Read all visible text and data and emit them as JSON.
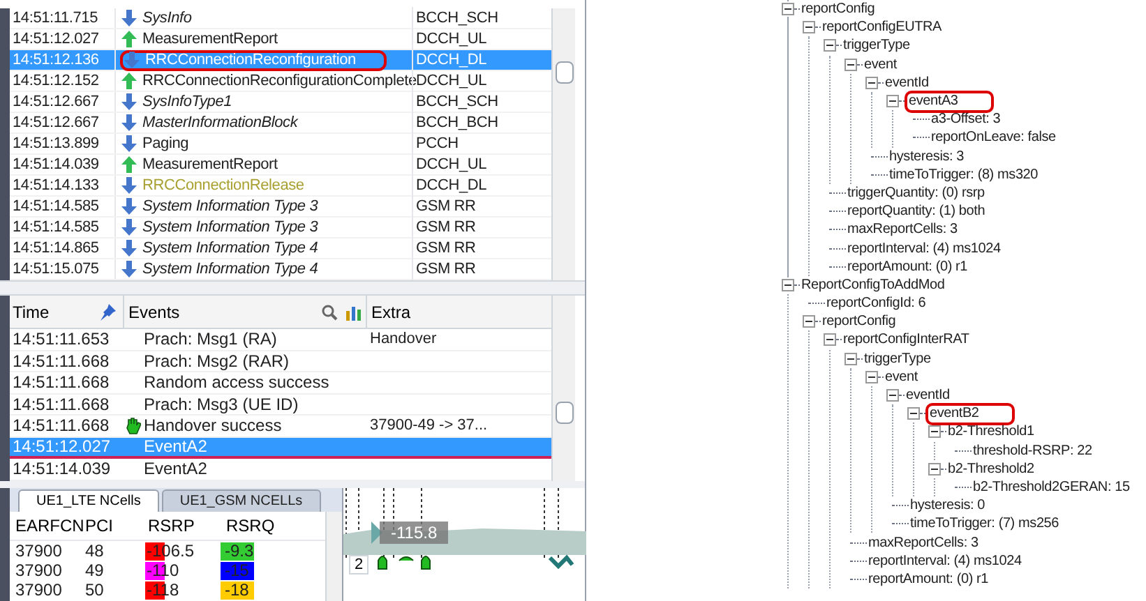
{
  "messages": {
    "rows": [
      {
        "time": "14:51:11.715",
        "kind": "downlink",
        "message": "SysInfo",
        "italic": true,
        "channel": "BCCH_SCH",
        "selected": false,
        "highlighted": false
      },
      {
        "time": "14:51:12.027",
        "kind": "uplink",
        "message": "MeasurementReport",
        "italic": false,
        "channel": "DCCH_UL",
        "selected": false,
        "highlighted": false
      },
      {
        "time": "14:51:12.136",
        "kind": "downlink",
        "message": "RRCConnectionReconfiguration",
        "italic": false,
        "channel": "DCCH_DL",
        "selected": true,
        "highlighted": true
      },
      {
        "time": "14:51:12.152",
        "kind": "uplink",
        "message": "RRCConnectionReconfigurationComplete",
        "italic": false,
        "channel": "DCCH_UL",
        "selected": false,
        "highlighted": false
      },
      {
        "time": "14:51:12.667",
        "kind": "downlink",
        "message": "SysInfoType1",
        "italic": true,
        "channel": "BCCH_SCH",
        "selected": false,
        "highlighted": false
      },
      {
        "time": "14:51:12.667",
        "kind": "downlink",
        "message": "MasterInformationBlock",
        "italic": true,
        "channel": "BCCH_BCH",
        "selected": false,
        "highlighted": false
      },
      {
        "time": "14:51:13.899",
        "kind": "downlink",
        "message": "Paging",
        "italic": false,
        "channel": "PCCH",
        "selected": false,
        "highlighted": false
      },
      {
        "time": "14:51:14.039",
        "kind": "uplink",
        "message": "MeasurementReport",
        "italic": false,
        "channel": "DCCH_UL",
        "selected": false,
        "highlighted": false
      },
      {
        "time": "14:51:14.133",
        "kind": "downlink",
        "message": "RRCConnectionRelease",
        "italic": false,
        "color": "#a8a030",
        "channel": "DCCH_DL",
        "selected": false,
        "highlighted": false
      },
      {
        "time": "14:51:14.585",
        "kind": "downlink",
        "message": "System Information Type 3",
        "italic": true,
        "channel": "GSM RR",
        "selected": false,
        "highlighted": false
      },
      {
        "time": "14:51:14.585",
        "kind": "downlink",
        "message": "System Information Type 3",
        "italic": true,
        "channel": "GSM RR",
        "selected": false,
        "highlighted": false
      },
      {
        "time": "14:51:14.865",
        "kind": "downlink",
        "message": "System Information Type 4",
        "italic": true,
        "channel": "GSM RR",
        "selected": false,
        "highlighted": false
      },
      {
        "time": "14:51:15.075",
        "kind": "downlink",
        "message": "System Information Type 4",
        "italic": true,
        "channel": "GSM RR",
        "selected": false,
        "highlighted": false
      }
    ]
  },
  "events": {
    "columns": [
      "Time",
      "Events",
      "Extra"
    ],
    "rows": [
      {
        "time": "14:51:11.653",
        "event": "Prach: Msg1 (RA)",
        "extra": "Handover",
        "kind": "plain",
        "selected": false
      },
      {
        "time": "14:51:11.668",
        "event": "Prach: Msg2 (RAR)",
        "kind": "plain",
        "selected": false
      },
      {
        "time": "14:51:11.668",
        "event": "Random access success",
        "kind": "plain",
        "selected": false
      },
      {
        "time": "14:51:11.668",
        "event": "Prach: Msg3 (UE ID)",
        "kind": "plain",
        "selected": false
      },
      {
        "time": "14:51:11.668",
        "event": "Handover success",
        "extra": "37900-49 -> 37...",
        "kind": "handover",
        "selected": false
      },
      {
        "time": "14:51:12.027",
        "event": "EventA2",
        "kind": "plain",
        "selected": true
      },
      {
        "time": "14:51:14.039",
        "event": "EventA2",
        "kind": "plain",
        "selected": false
      }
    ]
  },
  "ncells": {
    "tabs": [
      {
        "label": "UE1_LTE NCells",
        "selected": true
      },
      {
        "label": "UE1_GSM NCELLs",
        "selected": false
      }
    ],
    "columns": [
      "EARFCN",
      "PCI",
      "RSRP",
      "RSRQ"
    ],
    "rows": [
      {
        "earfcn": "37900",
        "pci": "48",
        "rsrp": {
          "value": "-106.5",
          "color": "#ff0000"
        },
        "rsrq": {
          "value": "-9.3",
          "color": "#33cc33"
        }
      },
      {
        "earfcn": "37900",
        "pci": "49",
        "rsrp": {
          "value": "-110",
          "color": "#ff00ff"
        },
        "rsrq": {
          "value": "-15",
          "color": "#0000ff"
        }
      },
      {
        "earfcn": "37900",
        "pci": "50",
        "rsrp": {
          "value": "-118",
          "color": "#ff0000"
        },
        "rsrq": {
          "value": "-18",
          "color": "#ffcc00"
        }
      }
    ]
  },
  "timeline": {
    "value": "-115.8",
    "marker": "2"
  },
  "tree": [
    {
      "label": "reportConfig",
      "children": [
        {
          "label": "reportConfigEUTRA",
          "children": [
            {
              "label": "triggerType",
              "children": [
                {
                  "label": "event",
                  "children": [
                    {
                      "label": "eventId",
                      "children": [
                        {
                          "label": "eventA3",
                          "highlighted": true,
                          "children": [
                            {
                              "label": "a3-Offset: 3"
                            },
                            {
                              "label": "reportOnLeave: false"
                            }
                          ]
                        }
                      ]
                    },
                    {
                      "label": "hysteresis: 3"
                    },
                    {
                      "label": "timeToTrigger: (8) ms320"
                    }
                  ]
                }
              ]
            },
            {
              "label": "triggerQuantity: (0) rsrp"
            },
            {
              "label": "reportQuantity: (1) both"
            },
            {
              "label": "maxReportCells: 3"
            },
            {
              "label": "reportInterval: (4) ms1024"
            },
            {
              "label": "reportAmount: (0) r1"
            }
          ]
        }
      ]
    },
    {
      "label": "ReportConfigToAddMod",
      "children": [
        {
          "label": "reportConfigId: 6"
        },
        {
          "label": "reportConfig",
          "children": [
            {
              "label": "reportConfigInterRAT",
              "children": [
                {
                  "label": "triggerType",
                  "children": [
                    {
                      "label": "event",
                      "children": [
                        {
                          "label": "eventId",
                          "children": [
                            {
                              "label": "eventB2",
                              "highlighted": true,
                              "children": [
                                {
                                  "label": "b2-Threshold1",
                                  "children": [
                                    {
                                      "label": "threshold-RSRP: 22"
                                    }
                                  ]
                                },
                                {
                                  "label": "b2-Threshold2",
                                  "children": [
                                    {
                                      "label": "b2-Threshold2GERAN: 15"
                                    }
                                  ]
                                }
                              ]
                            }
                          ]
                        },
                        {
                          "label": "hysteresis: 0"
                        },
                        {
                          "label": "timeToTrigger: (7) ms256"
                        }
                      ]
                    }
                  ]
                },
                {
                  "label": "maxReportCells: 3"
                },
                {
                  "label": "reportInterval: (4) ms1024"
                },
                {
                  "label": "reportAmount: (0) r1"
                }
              ]
            }
          ]
        }
      ]
    }
  ]
}
